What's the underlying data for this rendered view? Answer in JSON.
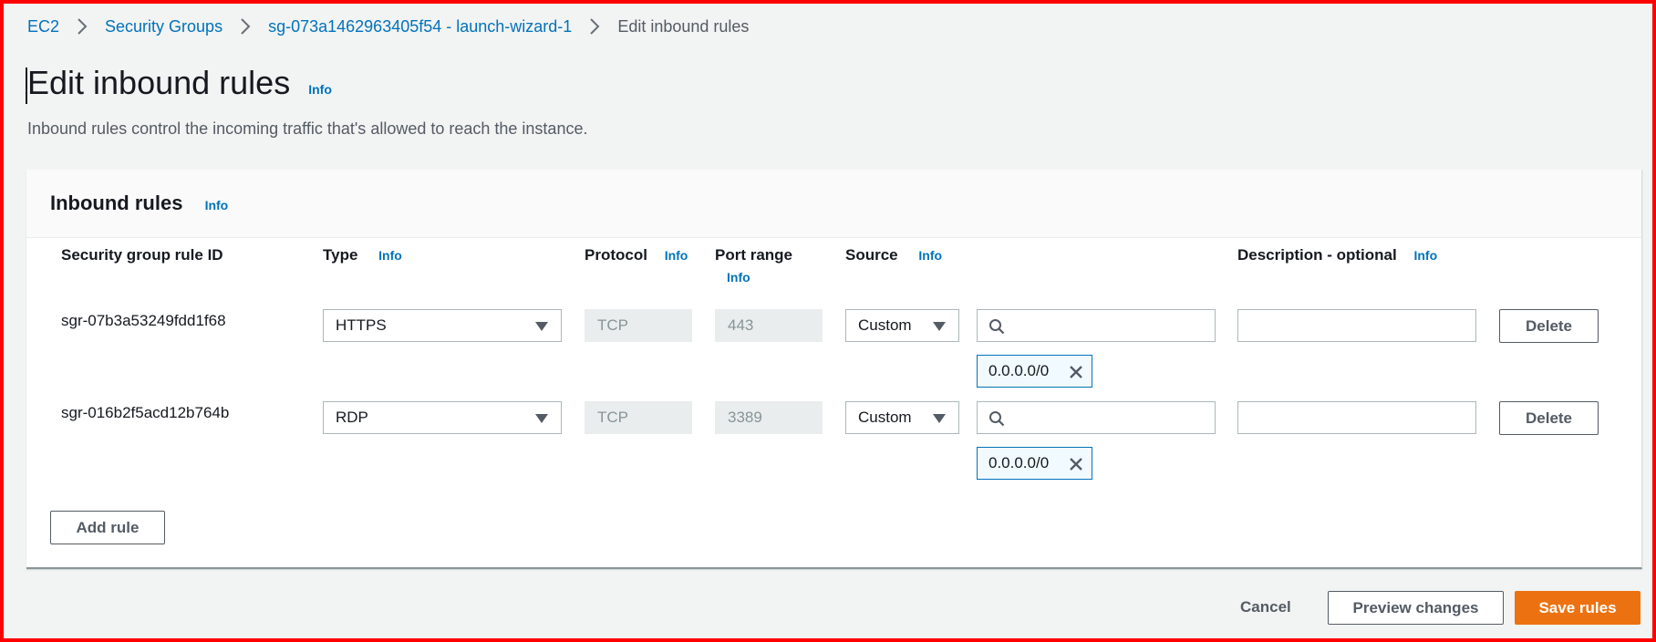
{
  "breadcrumb": {
    "items": [
      "EC2",
      "Security Groups",
      "sg-073a1462963405f54 - launch-wizard-1"
    ],
    "current": "Edit inbound rules"
  },
  "page": {
    "title": "Edit inbound rules",
    "info": "Info",
    "subtitle": "Inbound rules control the incoming traffic that's allowed to reach the instance."
  },
  "panel": {
    "title": "Inbound rules",
    "info": "Info",
    "columns": {
      "rule_id": "Security group rule ID",
      "type": "Type",
      "protocol": "Protocol",
      "port_range": "Port range",
      "source": "Source",
      "description": "Description - optional",
      "info": "Info"
    },
    "rows": [
      {
        "rule_id": "sgr-07b3a53249fdd1f68",
        "type": "HTTPS",
        "protocol": "TCP",
        "port_range": "443",
        "source_type": "Custom",
        "source_search_value": "",
        "source_token": "0.0.0.0/0",
        "description": "",
        "delete_label": "Delete"
      },
      {
        "rule_id": "sgr-016b2f5acd12b764b",
        "type": "RDP",
        "protocol": "TCP",
        "port_range": "3389",
        "source_type": "Custom",
        "source_search_value": "",
        "source_token": "0.0.0.0/0",
        "description": "",
        "delete_label": "Delete"
      }
    ],
    "add_rule_label": "Add rule"
  },
  "footer": {
    "cancel_label": "Cancel",
    "preview_label": "Preview changes",
    "save_label": "Save rules"
  },
  "colors": {
    "link": "#0073bb",
    "primary": "#ec7211",
    "frame": "#ff0000"
  },
  "icons": {
    "breadcrumb_separator": "chevron-right-icon",
    "dropdown": "caret-down-icon",
    "search": "search-icon",
    "remove_token": "close-icon"
  }
}
